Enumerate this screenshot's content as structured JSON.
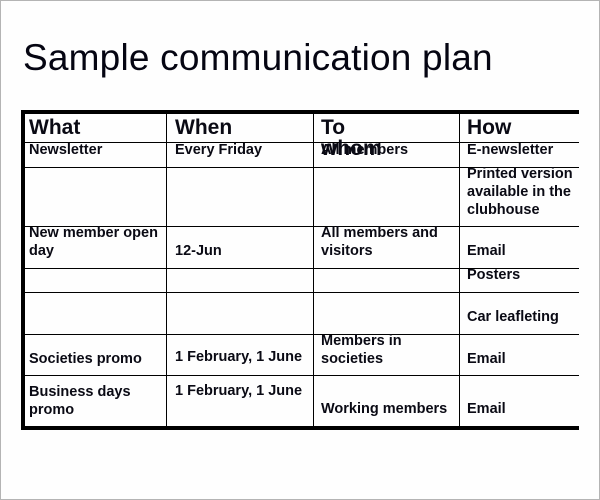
{
  "title": "Sample communication plan",
  "table": {
    "headers": [
      "What",
      "When",
      "To whom",
      "How"
    ],
    "rows": [
      {
        "what": "Newsletter",
        "when": "Every Friday",
        "to_whom": "All members",
        "how": "E-newsletter"
      },
      {
        "what": "",
        "when": "",
        "to_whom": "",
        "how": "Printed version available in the clubhouse",
        "how_lines": [
          "Printed version",
          "available in the",
          "clubhouse"
        ]
      },
      {
        "what": "New member open day",
        "what_lines": [
          "New member open",
          "day"
        ],
        "when": "12-Jun",
        "to_whom": "All members and visitors",
        "to_whom_lines": [
          "All members and",
          "visitors"
        ],
        "how": "Email"
      },
      {
        "what": "",
        "when": "",
        "to_whom": "",
        "how": "Posters"
      },
      {
        "what": "",
        "when": "",
        "to_whom": "",
        "how": "Car leafleting"
      },
      {
        "what": "Societies promo",
        "when": "1 February, 1 June",
        "to_whom": "Members in societies",
        "to_whom_lines": [
          "Members in",
          "societies"
        ],
        "how": "Email"
      },
      {
        "what": "Business days promo",
        "what_lines": [
          "Business days",
          "promo"
        ],
        "when": "1 February, 1 June",
        "to_whom": "Working members",
        "how": "Email"
      }
    ]
  }
}
